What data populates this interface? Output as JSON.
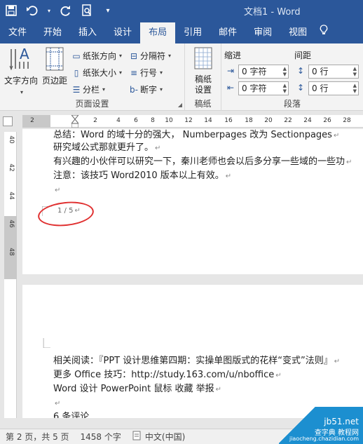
{
  "titlebar": {
    "title": "文档1 - Word"
  },
  "tabs": [
    "文件",
    "开始",
    "插入",
    "设计",
    "布局",
    "引用",
    "邮件",
    "审阅",
    "视图"
  ],
  "active_tab": "布局",
  "ribbon": {
    "page_setup": {
      "label": "页面设置",
      "text_direction": "文字方向",
      "margins": "页边距",
      "orientation": "纸张方向",
      "size": "纸张大小",
      "columns": "分栏",
      "breaks": "分隔符",
      "line_numbers": "行号",
      "hyphenation": "断字"
    },
    "paper": {
      "label": "稿纸",
      "button": "稿纸设置"
    },
    "paragraph": {
      "label": "段落",
      "indent_label": "缩进",
      "spacing_label": "间距",
      "indent_left": "0 字符",
      "indent_right": "0 字符",
      "spacing_before": "0 行",
      "spacing_after": "0 行"
    }
  },
  "ruler": {
    "ticks": [
      "2",
      "2",
      "4",
      "6",
      "8",
      "10",
      "12",
      "14",
      "16",
      "18",
      "20",
      "22",
      "24",
      "26",
      "28"
    ],
    "vticks": [
      "40",
      "42",
      "44",
      "46",
      "48"
    ]
  },
  "page1": {
    "lines": [
      "总结：Word 的域十分的强大， Numberpages 改为 Sectionpages",
      "研究域公式那就更升了。",
      "有兴趣的小伙伴可以研究一下，秦川老师也会以后多分享一些域的一些功",
      "注意：该技巧 Word2010 版本以上有效。",
      ""
    ],
    "page_number": "1 / 5"
  },
  "page2": {
    "lines": [
      "相关阅读：『PPT 设计思维第四期：实操单图版式的花样“变式”法则』",
      "更多 Office 技巧：http://study.163.com/u/nboffice",
      " Word  设计  PowerPoint  鼠标  收藏   举报",
      "",
      "6 条评论"
    ]
  },
  "statusbar": {
    "page": "第 2 页，共 5 页",
    "words": "1458 个字",
    "language": "中文(中国)"
  },
  "watermark": {
    "line1": "jb51.net",
    "line2": "查字典 教程网",
    "line3": "jiaocheng.chazidian.com"
  },
  "colors": {
    "accent": "#2b579a",
    "annotation": "#e03030"
  }
}
